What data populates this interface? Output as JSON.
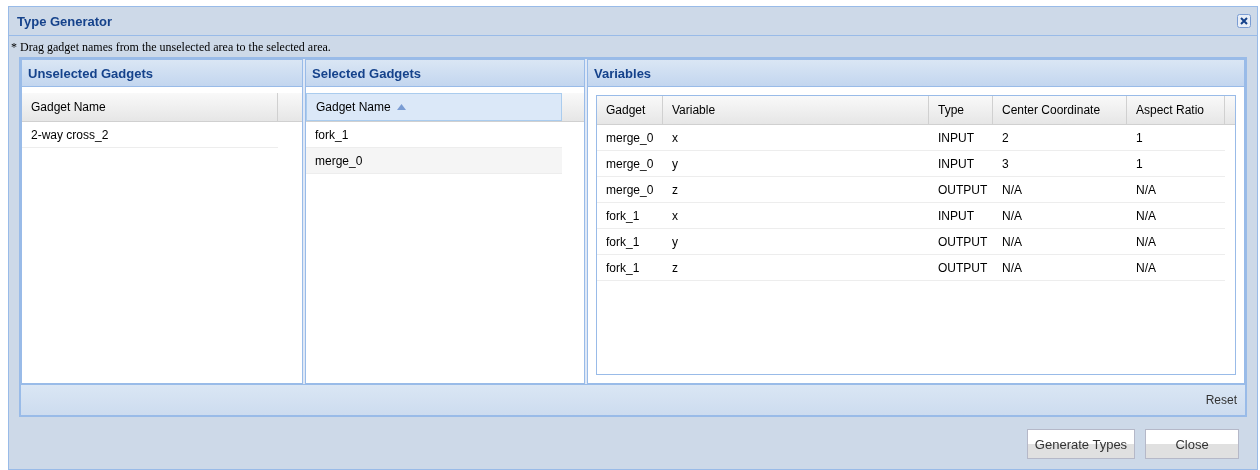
{
  "window": {
    "title": "Type Generator"
  },
  "hint": "* Drag gadget names from the unselected area to the selected area.",
  "unselected": {
    "title": "Unselected Gadgets",
    "column": {
      "label": "Gadget Name",
      "sorted": false
    },
    "rows": [
      "2-way cross_2"
    ]
  },
  "selected": {
    "title": "Selected Gadgets",
    "column": {
      "label": "Gadget Name",
      "sorted": true
    },
    "rows": [
      "fork_1",
      "merge_0"
    ]
  },
  "variables": {
    "title": "Variables",
    "columns": [
      "Gadget",
      "Variable",
      "Type",
      "Center Coordinate",
      "Aspect Ratio"
    ],
    "rows": [
      [
        "merge_0",
        "x",
        "INPUT",
        "2",
        "1"
      ],
      [
        "merge_0",
        "y",
        "INPUT",
        "3",
        "1"
      ],
      [
        "merge_0",
        "z",
        "OUTPUT",
        "N/A",
        "N/A"
      ],
      [
        "fork_1",
        "x",
        "INPUT",
        "N/A",
        "N/A"
      ],
      [
        "fork_1",
        "y",
        "OUTPUT",
        "N/A",
        "N/A"
      ],
      [
        "fork_1",
        "z",
        "OUTPUT",
        "N/A",
        "N/A"
      ]
    ]
  },
  "reset": "Reset",
  "buttons": [
    "Generate Types",
    "Close"
  ]
}
